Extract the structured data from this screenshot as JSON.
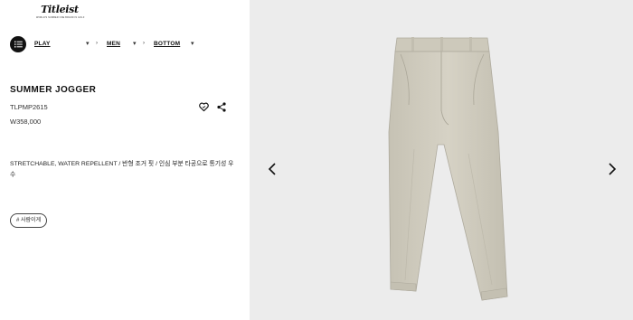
{
  "brand": {
    "logo_text": "Titleist",
    "tagline": "WORLD'S NUMBER ONE BRAND IN GOLF"
  },
  "breadcrumb": {
    "items": [
      {
        "label": "PLAY"
      },
      {
        "label": "MEN"
      },
      {
        "label": "BOTTOM"
      }
    ]
  },
  "product": {
    "name": "SUMMER JOGGER",
    "sku": "TLPMP2615",
    "price": "W358,000",
    "description": "STRETCHABLE, WATER REPELLENT / 반형 조거 핏 / 인심 부분 타공으로 통기성 우수",
    "tag": "# 사람이게",
    "image_color": "#d3cfc1"
  },
  "icons": {
    "menu": "list-menu-icon",
    "wishlist": "heart-icon",
    "share": "share-icon",
    "prev": "chevron-left-icon",
    "next": "chevron-right-icon"
  },
  "colors": {
    "panel_background": "#ececec",
    "text": "#111111"
  }
}
